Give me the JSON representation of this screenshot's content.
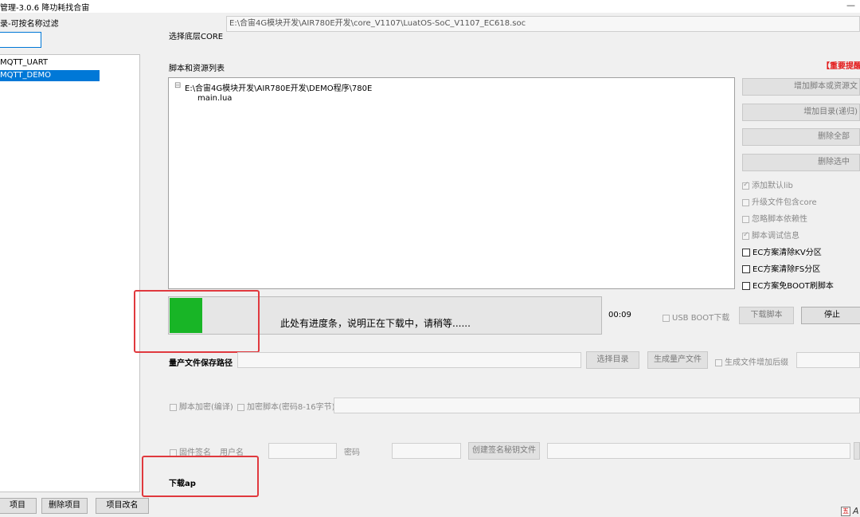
{
  "window": {
    "title": "管理-3.0.6 降功耗找合宙",
    "control": "—"
  },
  "left_panel": {
    "filter_label": "录-可按名称过滤",
    "filter_value": "",
    "projects": [
      "MQTT_UART",
      "MQTT_DEMO"
    ],
    "selected_index": 1,
    "buttons": {
      "add": "项目",
      "delete": "删除项目",
      "rename": "项目改名"
    }
  },
  "core": {
    "label": "选择底层CORE",
    "path": "E:\\合宙4G模块开发\\AIR780E开发\\core_V1107\\LuatOS-SoC_V1107_EC618.soc"
  },
  "scripts": {
    "label": "脚本和资源列表",
    "notice": "【重要提醒",
    "tree_root": "E:\\合宙4G模块开发\\AIR780E开发\\DEMO程序\\780E",
    "tree_root_toggle": "⊟",
    "files": [
      "main.lua"
    ]
  },
  "right_buttons": {
    "add_script": "增加脚本或资源文",
    "add_dir": "增加目录(递归)",
    "delete_all": "删除全部",
    "delete_selected": "删除选中"
  },
  "options": {
    "add_default_lib": "添加默认lib",
    "upgrade_with_core": "升级文件包含core",
    "ignore_deps": "忽略脚本依赖性",
    "debug_info": "脚本调试信息",
    "ec_clear_kv": "EC方案清除KV分区",
    "ec_clear_fs": "EC方案清除FS分区",
    "ec_no_boot": "EC方案免BOOT刷脚本"
  },
  "progress": {
    "value": 0.08,
    "color": "#18b526",
    "annotation": "此处有进度条，说明正在下载中，请稍等......",
    "time": "00:09",
    "usb_boot": "USB BOOT下载",
    "download_script": "下载脚本",
    "stop": "停止"
  },
  "production": {
    "label": "量产文件保存路径",
    "path_value": "",
    "choose_dir": "选择目录",
    "generate": "生成量产文件",
    "suffix_option": "生成文件增加后缀"
  },
  "encrypt": {
    "compile": "脚本加密(编译)",
    "password_encrypt": "加密脚本(密码8-16字节)"
  },
  "signing": {
    "firmware_sign": "固件签名",
    "username_label": "用户名",
    "password_label": "密码",
    "create_key": "创建签名秘钥文件"
  },
  "download": {
    "label": "下载ap"
  },
  "colors": {
    "selected": "#0078d7",
    "annotation_box": "#e0393e"
  }
}
